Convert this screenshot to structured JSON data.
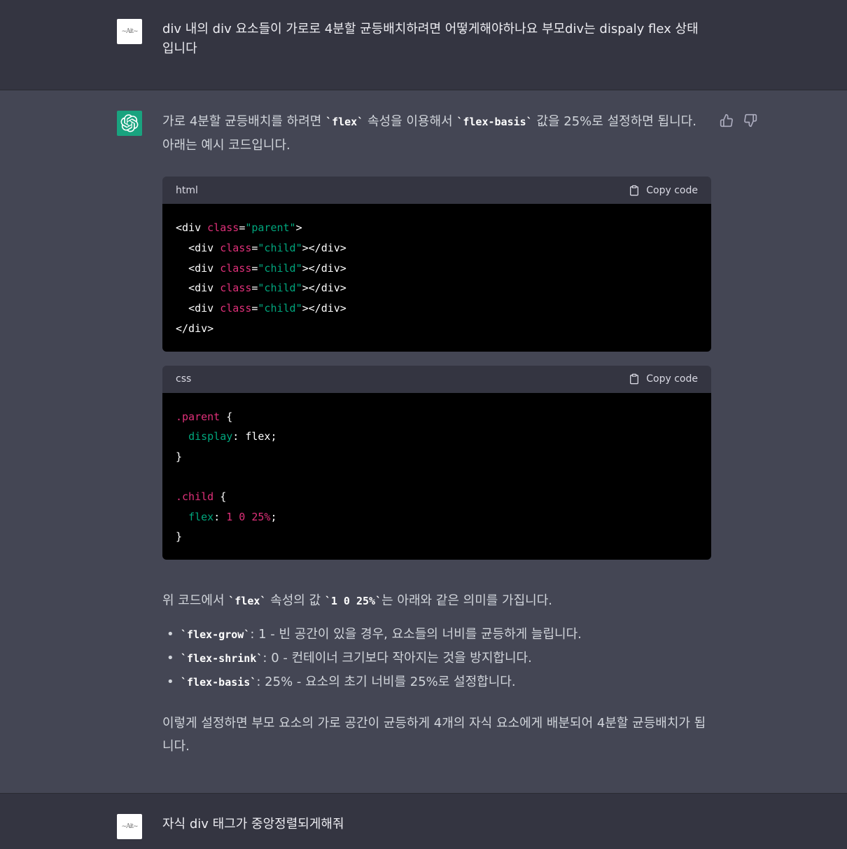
{
  "conversation": {
    "user_message_1": "div 내의 div 요소들이 가로로 4분할 균등배치하려면 어떻게해야하나요 부모div는 dispaly flex 상태입니다",
    "assistant": {
      "intro_part1": "가로 4분할 균등배치를 하려면 ",
      "intro_code1": "`flex`",
      "intro_part2": " 속성을 이용해서 ",
      "intro_code2": "`flex-basis`",
      "intro_part3": " 값을 25%로 설정하면 됩니다. 아래는 예시 코드입니다.",
      "copy_label": "Copy code",
      "code_html_lang": "html",
      "code_css_lang": "css",
      "explain_part1": "위 코드에서 ",
      "explain_code1": "`flex`",
      "explain_part2": " 속성의 값 ",
      "explain_code2": "`1 0 25%`",
      "explain_part3": "는 아래와 같은 의미를 가집니다.",
      "bullets": [
        {
          "code": "`flex-grow`",
          "text": ": 1 - 빈 공간이 있을 경우, 요소들의 너비를 균등하게 늘립니다."
        },
        {
          "code": "`flex-shrink`",
          "text": ": 0 - 컨테이너 크기보다 작아지는 것을 방지합니다."
        },
        {
          "code": "`flex-basis`",
          "text": ": 25% - 요소의 초기 너비를 25%로 설정합니다."
        }
      ],
      "conclusion": "이렇게 설정하면 부모 요소의 가로 공간이 균등하게 4개의 자식 요소에게 배분되어 4분할 균등배치가 됩니다."
    },
    "user_message_2": "자식 div 태그가 중앙정렬되게해줘"
  },
  "code": {
    "html": {
      "tag_open": "<div ",
      "attr": "class",
      "eq": "=",
      "parent_val": "\"parent\"",
      "child_val": "\"child\"",
      "close_gt": ">",
      "child_close": "></div>",
      "indent": "  ",
      "end_tag": "</div>"
    },
    "css": {
      "parent_sel": ".parent",
      "child_sel": ".child",
      "brace_open": " {",
      "brace_close": "}",
      "indent": "  ",
      "prop1": "display",
      "val1": ": flex;",
      "prop2": "flex",
      "colon": ": ",
      "val2": "1 0 25%",
      "semi": ";"
    }
  },
  "colors": {
    "background_user": "#343541",
    "background_assistant": "#444654",
    "gpt_avatar": "#19a37f",
    "code_bg": "#000000",
    "code_header": "#343541",
    "token_attr": "#df3079",
    "token_string": "#00a67d"
  },
  "icons": {
    "gpt_logo": "openai-logo-icon",
    "copy": "clipboard-icon",
    "thumbs_up": "thumbs-up-icon",
    "thumbs_down": "thumbs-down-icon"
  }
}
